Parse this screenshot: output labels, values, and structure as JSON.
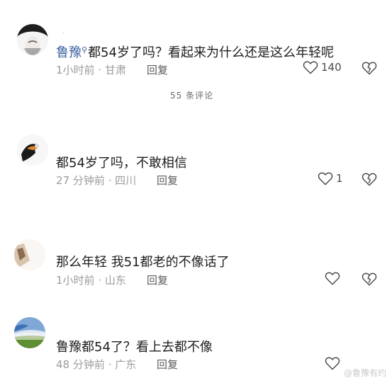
{
  "comments": [
    {
      "name": "·",
      "mention": "鲁豫",
      "text": "都54岁了吗？看起来为什么还是这么年轻呢",
      "time": "1小时前 · 甘肃",
      "reply_label": "回复",
      "like_count": "140"
    },
    {
      "name": "",
      "text": "都54岁了吗，不敢相信",
      "time": "27 分钟前 · 四川",
      "reply_label": "回复",
      "like_count": "1"
    },
    {
      "name": "",
      "text": "那么年轻 我51都老的不像话了",
      "time": "1小时前 · 山东",
      "reply_label": "回复",
      "like_count": ""
    },
    {
      "name": "",
      "text": "鲁豫都54了？看上去都不像",
      "time": "48 分钟前 · 广东",
      "reply_label": "回复",
      "like_count": ""
    }
  ],
  "reply_count_label": "55 条评论",
  "watermark": "@鲁豫有约",
  "icons": {
    "like": "heart-outline-icon",
    "dislike": "broken-heart-icon",
    "mention": "search-mention-icon"
  },
  "colors": {
    "mention": "#3b5f9e",
    "meta": "#9c9c9c",
    "icon": "#4a4a4a"
  }
}
